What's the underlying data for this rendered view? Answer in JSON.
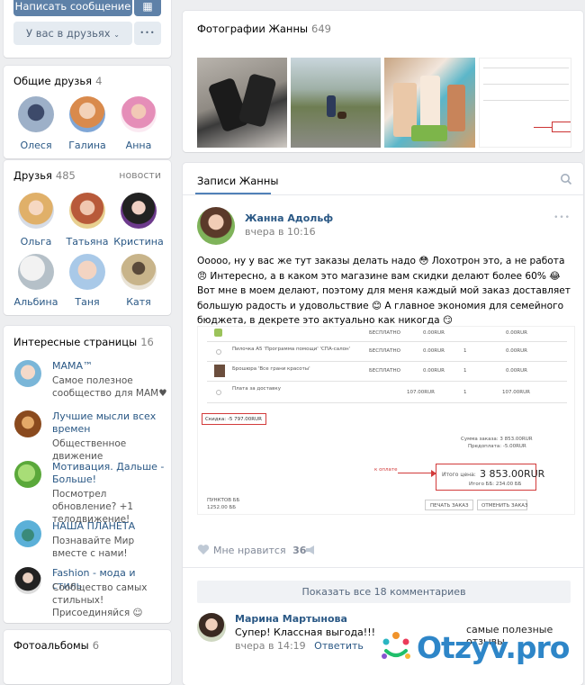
{
  "profile_actions": {
    "message_button": "Написать сообщение",
    "friends_button": "У вас в друзьях",
    "more_button": "•••"
  },
  "common_friends": {
    "title": "Общие друзья",
    "count": "4",
    "items": [
      {
        "name": "Олеся"
      },
      {
        "name": "Галина"
      },
      {
        "name": "Анна"
      }
    ]
  },
  "friends": {
    "title": "Друзья",
    "count": "485",
    "news_link": "новости",
    "items": [
      {
        "name": "Ольга"
      },
      {
        "name": "Татьяна"
      },
      {
        "name": "Кристина"
      },
      {
        "name": "Альбина"
      },
      {
        "name": "Таня"
      },
      {
        "name": "Катя"
      }
    ]
  },
  "interesting_pages": {
    "title": "Интересные страницы",
    "count": "16",
    "items": [
      {
        "name": "МАМА™",
        "desc": "Самое полезное сообщество для МАМ♥"
      },
      {
        "name": "Лучшие мысли всех времен",
        "desc": "Общественное движение"
      },
      {
        "name": "Мотивация. Дальше - Больше!",
        "desc": "Посмотрел обновление? +1 телодвижение!"
      },
      {
        "name": "НАША ПЛАНЕТА",
        "desc": "Познавайте Мир вместе с нами!"
      },
      {
        "name": "Fashion - мода и стиль",
        "desc": "Сообщество самых стильных! Присоединяйся ☺"
      }
    ]
  },
  "albums": {
    "title": "Фотоальбомы",
    "count": "6"
  },
  "photos": {
    "title": "Фотографии Жанны",
    "count": "649"
  },
  "wall": {
    "tab": "Записи Жанны",
    "post": {
      "author": "Жанна Адольф",
      "time": "вчера в 10:16",
      "text": "Ооооо, ну у вас же тут заказы делать надо 😳 Лохотрон это, а не работа 😠 Интересно, а в каком это магазине вам скидки делают более 60% 😂 Вот мне в моем делают, поэтому для меня каждый мой заказ доставляет большую радость и удовольствие 😊 А главное экономия для семейного бюджета, в декрете это актуально как никогда 😏",
      "likes_label": "Мне нравится",
      "likes_count": "36",
      "show_comments": "Показать все 18 комментариев"
    },
    "screenshot": {
      "rows": [
        {
          "name": "Пилочка А5 'Программа помощи' 'СПА-салон'",
          "price": "БЕСПЛАТНО",
          "total": "0.00RUR",
          "qty": "1",
          "sum": "0.00RUR"
        },
        {
          "name": "Брошюра 'Все грани красоты'",
          "price": "БЕСПЛАТНО",
          "total": "0.00RUR",
          "qty": "1",
          "sum": "0.00RUR"
        },
        {
          "name": "Плата за доставку",
          "price": "",
          "total": "107.00RUR",
          "qty": "1",
          "sum": "107.00RUR"
        }
      ],
      "discount_label": "Скидка: -5 797.00RUR",
      "order_sum": "Сумма заказа: 3 853.00RUR",
      "prepay": "Предоплата: -5.00RUR",
      "arrow_label": "к оплате",
      "total_label": "Итого цена:",
      "total_value": "3 853.00RUR",
      "total_sub": "Итого ББ: 234.00 ББ",
      "points_label": "ПУНКТОВ ББ",
      "points_value": "1252.00 ББ",
      "print_button": "ПЕЧАТЬ ЗАКАЗ",
      "cancel_button": "ОТМЕНИТЬ ЗАКАЗ",
      "first_row_fragment": "0.00RUR",
      "first_row_price": "БЕСПЛАТНО"
    },
    "comment": {
      "author": "Марина Мартынова",
      "text": "Супер! Классная выгода!!!",
      "time": "вчера в 14:19",
      "reply": "Ответить"
    }
  },
  "watermark": {
    "caption": "самые полезные отзывы",
    "brand": "Otzyv.pro"
  }
}
